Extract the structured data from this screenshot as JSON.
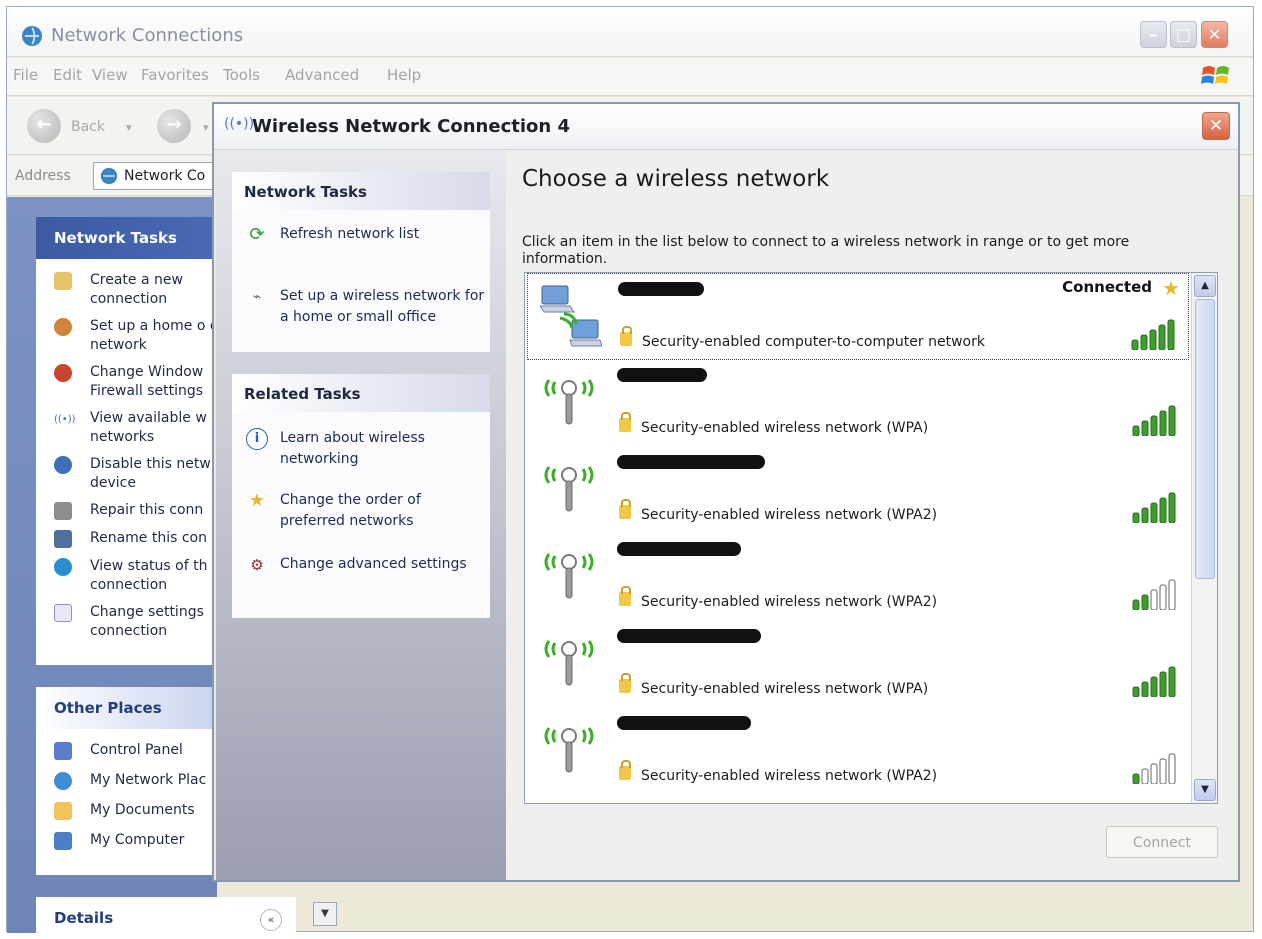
{
  "outer_window": {
    "title": "Network Connections",
    "menu": [
      "File",
      "Edit",
      "View",
      "Favorites",
      "Tools",
      "Advanced",
      "Help"
    ],
    "toolbar": {
      "back_label": "Back",
      "back_drop": "▾",
      "forward_drop": "▾"
    },
    "address": {
      "label": "Address",
      "value": "Network Co"
    },
    "sidebar": {
      "network_tasks": {
        "title": "Network Tasks",
        "items": [
          "Create a new connection",
          "Set up a home o office network",
          "Change Window Firewall settings",
          "View available w networks",
          "Disable this netw device",
          "Repair this conn",
          "Rename this con",
          "View status of th connection",
          "Change settings connection"
        ]
      },
      "other_places": {
        "title": "Other Places",
        "items": [
          "Control Panel",
          "My Network Plac",
          "My Documents",
          "My Computer"
        ]
      },
      "details": {
        "title": "Details",
        "chevron": "«"
      }
    }
  },
  "dialog": {
    "title": "Wireless Network Connection 4",
    "network_tasks": {
      "title": "Network Tasks",
      "items": [
        "Refresh network list",
        "Set up a wireless network for a home or small office"
      ]
    },
    "related_tasks": {
      "title": "Related Tasks",
      "items": [
        "Learn about wireless networking",
        "Change the order of preferred networks",
        "Change advanced settings"
      ]
    },
    "heading": "Choose a wireless network",
    "instruction": "Click an item in the list below to connect to a wireless network in range or to get more information.",
    "networks": [
      {
        "status": "Connected",
        "security": "Security-enabled computer-to-computer network",
        "signal": 5,
        "type": "adhoc",
        "selected": true
      },
      {
        "status": "",
        "security": "Security-enabled wireless network (WPA)",
        "signal": 5,
        "type": "ap",
        "selected": false
      },
      {
        "status": "",
        "security": "Security-enabled wireless network (WPA2)",
        "signal": 5,
        "type": "ap",
        "selected": false
      },
      {
        "status": "",
        "security": "Security-enabled wireless network (WPA2)",
        "signal": 2,
        "type": "ap",
        "selected": false
      },
      {
        "status": "",
        "security": "Security-enabled wireless network (WPA)",
        "signal": 5,
        "type": "ap",
        "selected": false
      },
      {
        "status": "",
        "security": "Security-enabled wireless network (WPA2)",
        "signal": 1,
        "type": "ap",
        "selected": false
      }
    ],
    "connect_button": "Connect"
  },
  "colors": {
    "signal_on": "#3f9d2d",
    "signal_off": "#ffffff",
    "sidebar_blue": "#7086bb",
    "title_close": "#d9613f"
  }
}
